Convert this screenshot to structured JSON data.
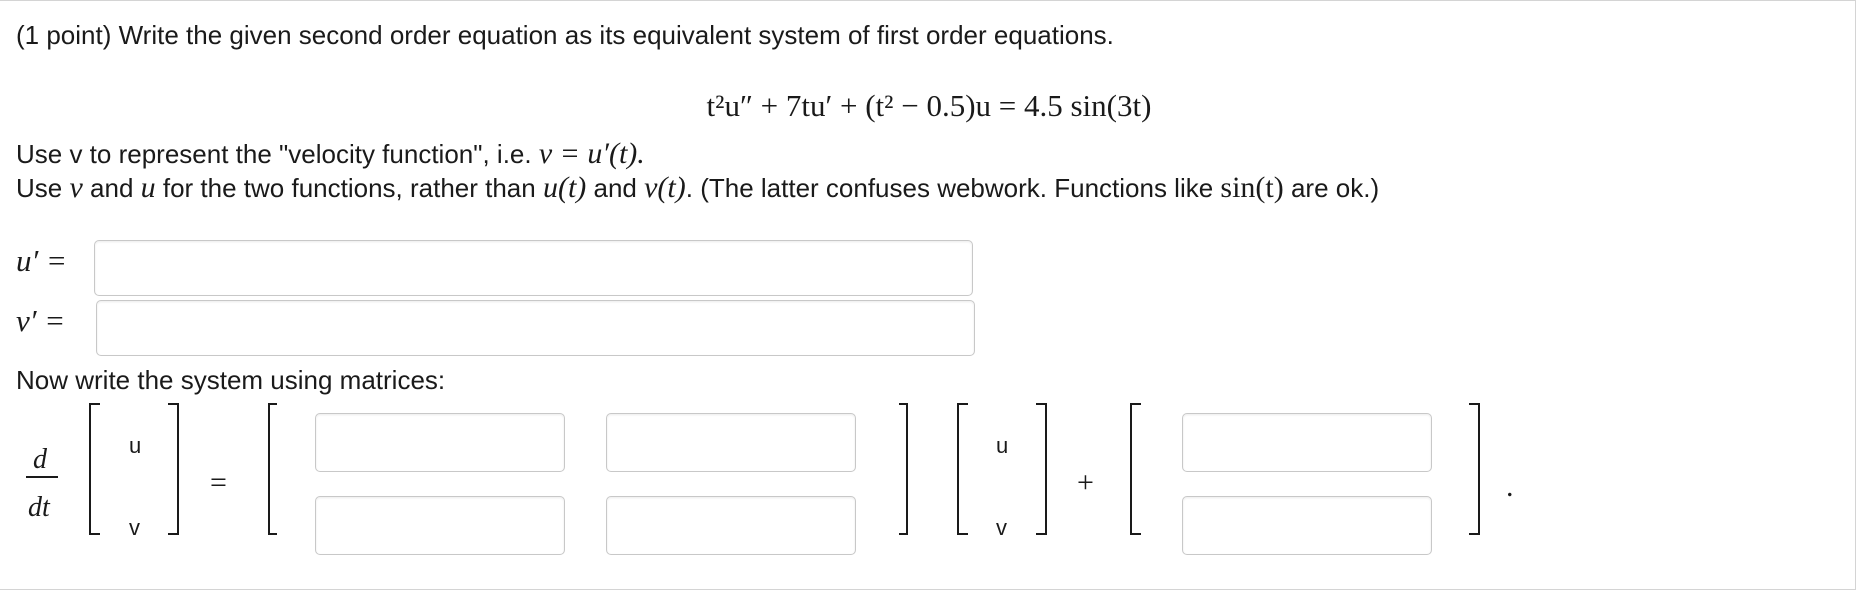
{
  "problem": {
    "prompt": "(1 point) Write the given second order equation as its equivalent system of first order equations.",
    "equation": {
      "term1": "t²u″ + 7tu′ + (t² − 0.5)u = 4.5 sin(3t)"
    },
    "line1_text": "Use v to represent the \"velocity function\", i.e. ",
    "line1_math": "v = u′(t).",
    "line2_a": "Use ",
    "line2_v": "v",
    "line2_b": " and ",
    "line2_u": "u",
    "line2_c": " for the two functions, rather than ",
    "line2_ut": "u(t)",
    "line2_d": " and ",
    "line2_vt": "v(t)",
    "line2_e": ". (The latter confuses webwork. Functions like ",
    "line2_sin": "sin(t)",
    "line2_f": " are ok.)",
    "u_prime_label": "u′ =",
    "v_prime_label": "v′ =",
    "u_prime_value": "",
    "v_prime_value": "",
    "matrix_prompt": "Now write the system using matrices:",
    "ddt_d": "d",
    "ddt_dt": "dt",
    "vec_u": "u",
    "vec_v": "v",
    "equals": "=",
    "plus": "+",
    "period": ".",
    "matrix": {
      "a11": "",
      "a12": "",
      "a21": "",
      "a22": "",
      "b1": "",
      "b2": ""
    }
  }
}
